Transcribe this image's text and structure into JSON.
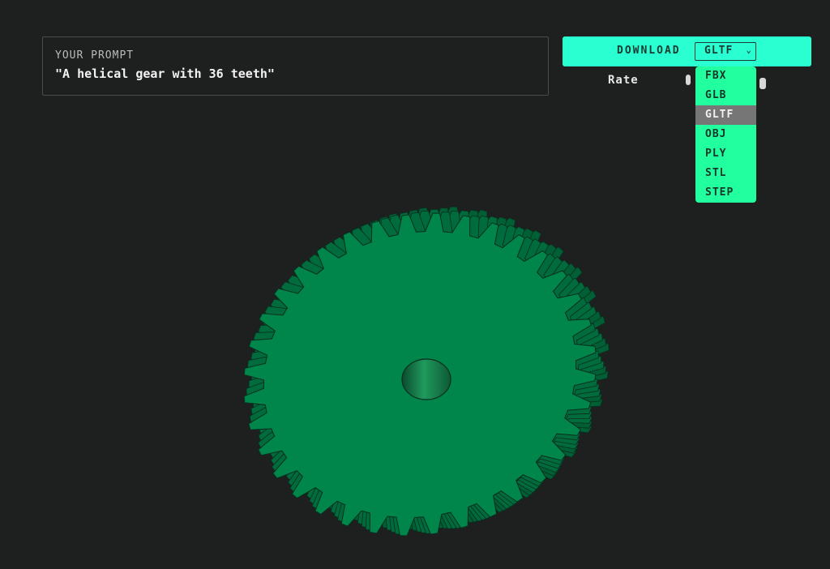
{
  "prompt": {
    "label": "YOUR PROMPT",
    "text": "\"A helical gear with 36 teeth\""
  },
  "download": {
    "label": "DOWNLOAD",
    "selected_format": "GLTF",
    "options": [
      "FBX",
      "GLB",
      "GLTF",
      "OBJ",
      "PLY",
      "STL",
      "STEP"
    ]
  },
  "rate": {
    "label": "Rate"
  },
  "model": {
    "teeth": 36,
    "color": "#00854a"
  },
  "colors": {
    "background": "#1e1f1f",
    "accent": "#2affd2",
    "dropdown": "#22ff9e",
    "gear": "#00854a"
  }
}
